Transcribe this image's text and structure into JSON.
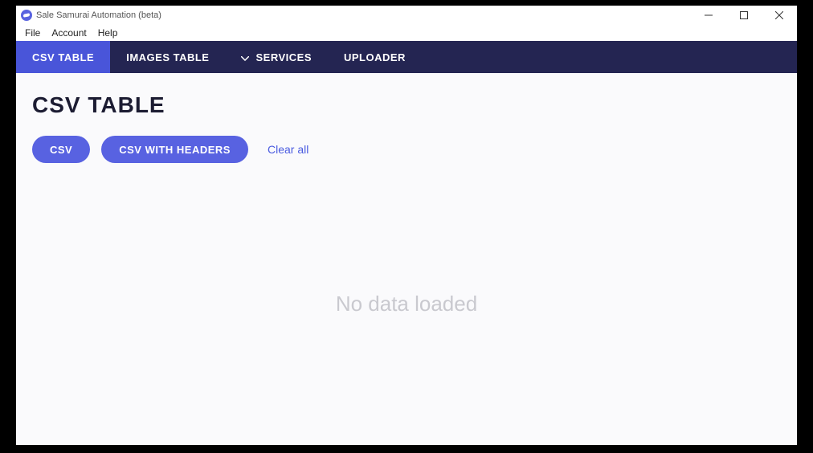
{
  "window": {
    "title": "Sale Samurai Automation (beta)"
  },
  "menu": {
    "items": [
      "File",
      "Account",
      "Help"
    ]
  },
  "tabs": {
    "items": [
      {
        "label": "CSV TABLE",
        "active": true,
        "dropdown": false
      },
      {
        "label": "IMAGES TABLE",
        "active": false,
        "dropdown": false
      },
      {
        "label": "SERVICES",
        "active": false,
        "dropdown": true
      },
      {
        "label": "UPLOADER",
        "active": false,
        "dropdown": false
      }
    ]
  },
  "page": {
    "title": "CSV TABLE",
    "csv_button": "CSV",
    "csv_headers_button": "CSV WITH HEADERS",
    "clear_all": "Clear all",
    "empty_message": "No data loaded"
  }
}
